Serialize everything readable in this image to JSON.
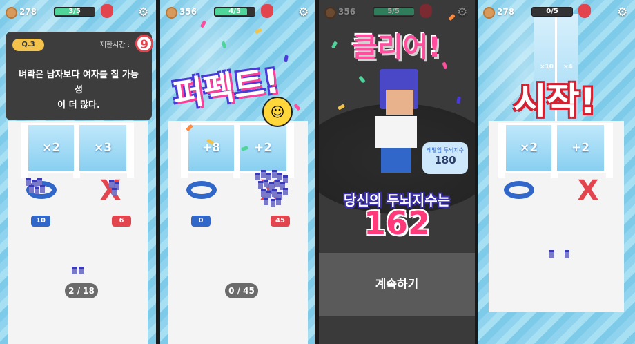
{
  "panel1": {
    "hud": {
      "coins": "278",
      "progress_text": "3/5",
      "progress": 0.6
    },
    "question": {
      "number": "Q.3",
      "time_limit_label": "제한시간 :",
      "timer": "9",
      "text_line1": "벼락은 남자보다 여자를 칠 가능성",
      "text_line2": "이 더 많다."
    },
    "gates": {
      "left": "×2",
      "right": "×3"
    },
    "counts": {
      "o": "10",
      "x": "6"
    },
    "crowd_counter": "2 / 18"
  },
  "panel2": {
    "hud": {
      "coins": "356",
      "progress_text": "4/5",
      "progress": 0.8
    },
    "overlay": "퍼펙트!",
    "gates": {
      "left": "+8",
      "right": "+2"
    },
    "counts": {
      "o": "0",
      "x": "45"
    },
    "crowd_counter": "0 / 45"
  },
  "panel3": {
    "hud": {
      "coins": "356",
      "progress_text": "5/5",
      "progress": 1.0
    },
    "overlay": "클리어!",
    "bubble_label": "레벨업 두뇌지수",
    "bubble_value": "180",
    "iq_label": "당신의 두뇌지수는",
    "iq_value": "162",
    "continue_label": "계속하기"
  },
  "panel4": {
    "hud": {
      "coins": "278",
      "progress_text": "0/5",
      "progress": 0.0
    },
    "overlay": "시작!",
    "tower_mults": [
      "×10",
      "×4"
    ],
    "gates": {
      "left": "×2",
      "right": "+2"
    }
  },
  "colors": {
    "blue": "#3067c9",
    "red": "#e3454f",
    "accent_green": "#4fd59a",
    "pink": "#ff3a7a"
  },
  "icons": {
    "coin": "coin-icon",
    "bag": "money-bag-icon",
    "gear": "gear-icon",
    "smiley": "smiley-icon"
  }
}
